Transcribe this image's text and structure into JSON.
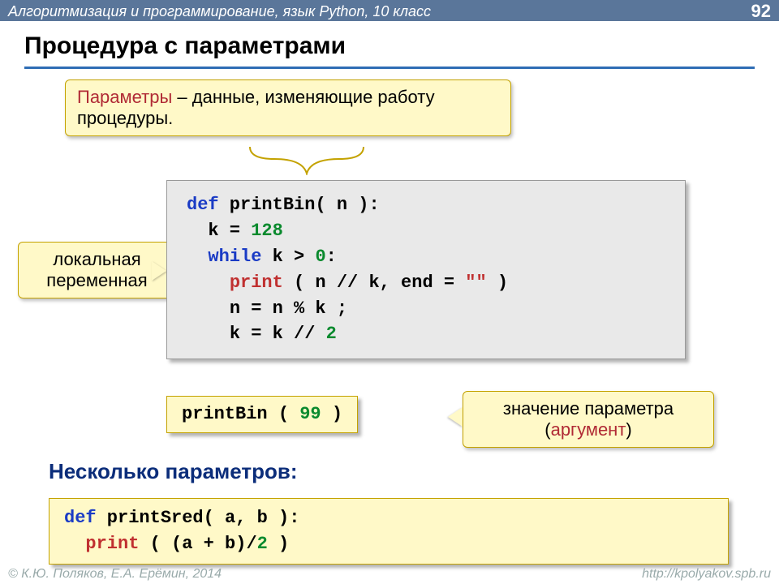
{
  "header": {
    "course": "Алгоритмизация и программирование, язык Python, 10 класс",
    "page": "92"
  },
  "title": "Процедура с параметрами",
  "callouts": {
    "params": {
      "keyword": "Параметры",
      "rest": " – данные, изменяющие работу процедуры."
    },
    "localvar": "локальная переменная",
    "argument": {
      "line1": "значение параметра",
      "line2_pre": "(",
      "line2_kw": "аргумент",
      "line2_post": ")"
    }
  },
  "subtitle": "Несколько параметров:",
  "code": {
    "main": {
      "l1": {
        "kw": "def",
        "name": " printBin",
        "paren_open": "( ",
        "param": "n",
        "paren_close": " ):"
      },
      "l2": {
        "ind": "  ",
        "var": "k",
        "op": " = ",
        "num": "128"
      },
      "l3": {
        "ind": "  ",
        "kw": "while",
        "cond_l": " k ",
        "gt": ">",
        "cond_r": " ",
        "zero": "0",
        "colon": ":"
      },
      "l4": {
        "ind": "    ",
        "fn": "print",
        "args_open": " ( n ",
        "slashes": "//",
        "args_mid": " k, end = ",
        "str": "\"\"",
        "args_close": " )"
      },
      "l5": {
        "ind": "    ",
        "var": "n",
        "rest": " = n % k ;"
      },
      "l6": {
        "ind": "    ",
        "var": "k",
        "rest_a": " = k ",
        "slashes": "//",
        "num": " 2"
      }
    },
    "call": {
      "name": "printBin",
      "open": " ( ",
      "arg": "99",
      "close": " )"
    },
    "sred": {
      "l1": {
        "kw": "def",
        "name": " printSred",
        "params": "( a, b ):"
      },
      "l2": {
        "ind": "  ",
        "fn": "print",
        "args": " ( (a + b)/",
        "two": "2",
        "close": " )"
      }
    }
  },
  "footer": {
    "left": "© К.Ю. Поляков, Е.А. Ерёмин, 2014",
    "right": "http://kpolyakov.spb.ru"
  }
}
